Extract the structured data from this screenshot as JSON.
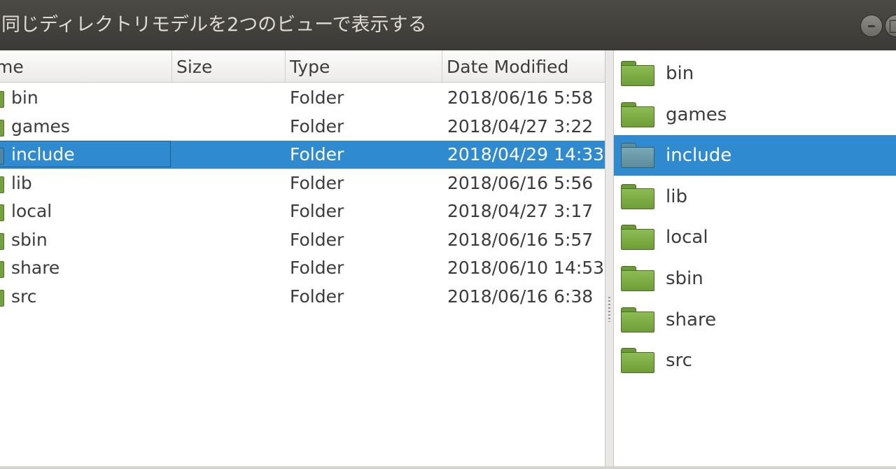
{
  "window": {
    "title": "同じディレクトリモデルを2つのビューで表示する",
    "minimize_glyph": "–",
    "maximize_glyph": "□"
  },
  "list_view": {
    "columns": [
      "me",
      "Size",
      "Type",
      "Date Modified"
    ],
    "rows": [
      {
        "name": "bin",
        "size": "",
        "type": "Folder",
        "date": "2018/06/16 5:58",
        "selected": false
      },
      {
        "name": "games",
        "size": "",
        "type": "Folder",
        "date": "2018/04/27 3:22",
        "selected": false
      },
      {
        "name": "include",
        "size": "",
        "type": "Folder",
        "date": "2018/04/29 14:33",
        "selected": true
      },
      {
        "name": "lib",
        "size": "",
        "type": "Folder",
        "date": "2018/06/16 5:56",
        "selected": false
      },
      {
        "name": "local",
        "size": "",
        "type": "Folder",
        "date": "2018/04/27 3:17",
        "selected": false
      },
      {
        "name": "sbin",
        "size": "",
        "type": "Folder",
        "date": "2018/06/16 5:57",
        "selected": false
      },
      {
        "name": "share",
        "size": "",
        "type": "Folder",
        "date": "2018/06/10 14:53",
        "selected": false
      },
      {
        "name": "src",
        "size": "",
        "type": "Folder",
        "date": "2018/06/16 6:38",
        "selected": false
      }
    ]
  },
  "icon_view": {
    "items": [
      {
        "name": "bin",
        "icon": "folder-icon",
        "selected": false
      },
      {
        "name": "games",
        "icon": "folder-icon",
        "selected": false
      },
      {
        "name": "include",
        "icon": "folder-icon",
        "selected": true
      },
      {
        "name": "lib",
        "icon": "folder-icon",
        "selected": false
      },
      {
        "name": "local",
        "icon": "folder-icon",
        "selected": false
      },
      {
        "name": "sbin",
        "icon": "folder-icon",
        "selected": false
      },
      {
        "name": "share",
        "icon": "folder-icon",
        "selected": false
      },
      {
        "name": "src",
        "icon": "folder-icon",
        "selected": false
      }
    ]
  },
  "colors": {
    "selection": "#2f8ad0",
    "titlebar": "#3b3a36",
    "folder": "#7aa843"
  }
}
